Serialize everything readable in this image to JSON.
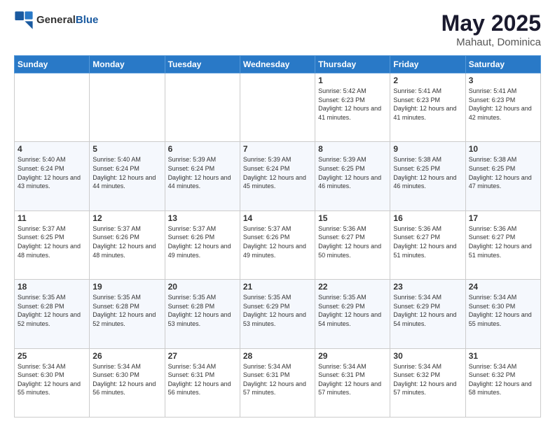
{
  "header": {
    "logo": {
      "general": "General",
      "blue": "Blue"
    },
    "title": "May 2025",
    "location": "Mahaut, Dominica"
  },
  "calendar": {
    "days_of_week": [
      "Sunday",
      "Monday",
      "Tuesday",
      "Wednesday",
      "Thursday",
      "Friday",
      "Saturday"
    ],
    "weeks": [
      [
        {
          "day": "",
          "info": ""
        },
        {
          "day": "",
          "info": ""
        },
        {
          "day": "",
          "info": ""
        },
        {
          "day": "",
          "info": ""
        },
        {
          "day": "1",
          "sunrise": "5:42 AM",
          "sunset": "6:23 PM",
          "daylight": "12 hours and 41 minutes."
        },
        {
          "day": "2",
          "sunrise": "5:41 AM",
          "sunset": "6:23 PM",
          "daylight": "12 hours and 41 minutes."
        },
        {
          "day": "3",
          "sunrise": "5:41 AM",
          "sunset": "6:23 PM",
          "daylight": "12 hours and 42 minutes."
        }
      ],
      [
        {
          "day": "4",
          "sunrise": "5:40 AM",
          "sunset": "6:24 PM",
          "daylight": "12 hours and 43 minutes."
        },
        {
          "day": "5",
          "sunrise": "5:40 AM",
          "sunset": "6:24 PM",
          "daylight": "12 hours and 44 minutes."
        },
        {
          "day": "6",
          "sunrise": "5:39 AM",
          "sunset": "6:24 PM",
          "daylight": "12 hours and 44 minutes."
        },
        {
          "day": "7",
          "sunrise": "5:39 AM",
          "sunset": "6:24 PM",
          "daylight": "12 hours and 45 minutes."
        },
        {
          "day": "8",
          "sunrise": "5:39 AM",
          "sunset": "6:25 PM",
          "daylight": "12 hours and 46 minutes."
        },
        {
          "day": "9",
          "sunrise": "5:38 AM",
          "sunset": "6:25 PM",
          "daylight": "12 hours and 46 minutes."
        },
        {
          "day": "10",
          "sunrise": "5:38 AM",
          "sunset": "6:25 PM",
          "daylight": "12 hours and 47 minutes."
        }
      ],
      [
        {
          "day": "11",
          "sunrise": "5:37 AM",
          "sunset": "6:25 PM",
          "daylight": "12 hours and 48 minutes."
        },
        {
          "day": "12",
          "sunrise": "5:37 AM",
          "sunset": "6:26 PM",
          "daylight": "12 hours and 48 minutes."
        },
        {
          "day": "13",
          "sunrise": "5:37 AM",
          "sunset": "6:26 PM",
          "daylight": "12 hours and 49 minutes."
        },
        {
          "day": "14",
          "sunrise": "5:37 AM",
          "sunset": "6:26 PM",
          "daylight": "12 hours and 49 minutes."
        },
        {
          "day": "15",
          "sunrise": "5:36 AM",
          "sunset": "6:27 PM",
          "daylight": "12 hours and 50 minutes."
        },
        {
          "day": "16",
          "sunrise": "5:36 AM",
          "sunset": "6:27 PM",
          "daylight": "12 hours and 51 minutes."
        },
        {
          "day": "17",
          "sunrise": "5:36 AM",
          "sunset": "6:27 PM",
          "daylight": "12 hours and 51 minutes."
        }
      ],
      [
        {
          "day": "18",
          "sunrise": "5:35 AM",
          "sunset": "6:28 PM",
          "daylight": "12 hours and 52 minutes."
        },
        {
          "day": "19",
          "sunrise": "5:35 AM",
          "sunset": "6:28 PM",
          "daylight": "12 hours and 52 minutes."
        },
        {
          "day": "20",
          "sunrise": "5:35 AM",
          "sunset": "6:28 PM",
          "daylight": "12 hours and 53 minutes."
        },
        {
          "day": "21",
          "sunrise": "5:35 AM",
          "sunset": "6:29 PM",
          "daylight": "12 hours and 53 minutes."
        },
        {
          "day": "22",
          "sunrise": "5:35 AM",
          "sunset": "6:29 PM",
          "daylight": "12 hours and 54 minutes."
        },
        {
          "day": "23",
          "sunrise": "5:34 AM",
          "sunset": "6:29 PM",
          "daylight": "12 hours and 54 minutes."
        },
        {
          "day": "24",
          "sunrise": "5:34 AM",
          "sunset": "6:30 PM",
          "daylight": "12 hours and 55 minutes."
        }
      ],
      [
        {
          "day": "25",
          "sunrise": "5:34 AM",
          "sunset": "6:30 PM",
          "daylight": "12 hours and 55 minutes."
        },
        {
          "day": "26",
          "sunrise": "5:34 AM",
          "sunset": "6:30 PM",
          "daylight": "12 hours and 56 minutes."
        },
        {
          "day": "27",
          "sunrise": "5:34 AM",
          "sunset": "6:31 PM",
          "daylight": "12 hours and 56 minutes."
        },
        {
          "day": "28",
          "sunrise": "5:34 AM",
          "sunset": "6:31 PM",
          "daylight": "12 hours and 57 minutes."
        },
        {
          "day": "29",
          "sunrise": "5:34 AM",
          "sunset": "6:31 PM",
          "daylight": "12 hours and 57 minutes."
        },
        {
          "day": "30",
          "sunrise": "5:34 AM",
          "sunset": "6:32 PM",
          "daylight": "12 hours and 57 minutes."
        },
        {
          "day": "31",
          "sunrise": "5:34 AM",
          "sunset": "6:32 PM",
          "daylight": "12 hours and 58 minutes."
        }
      ]
    ]
  }
}
